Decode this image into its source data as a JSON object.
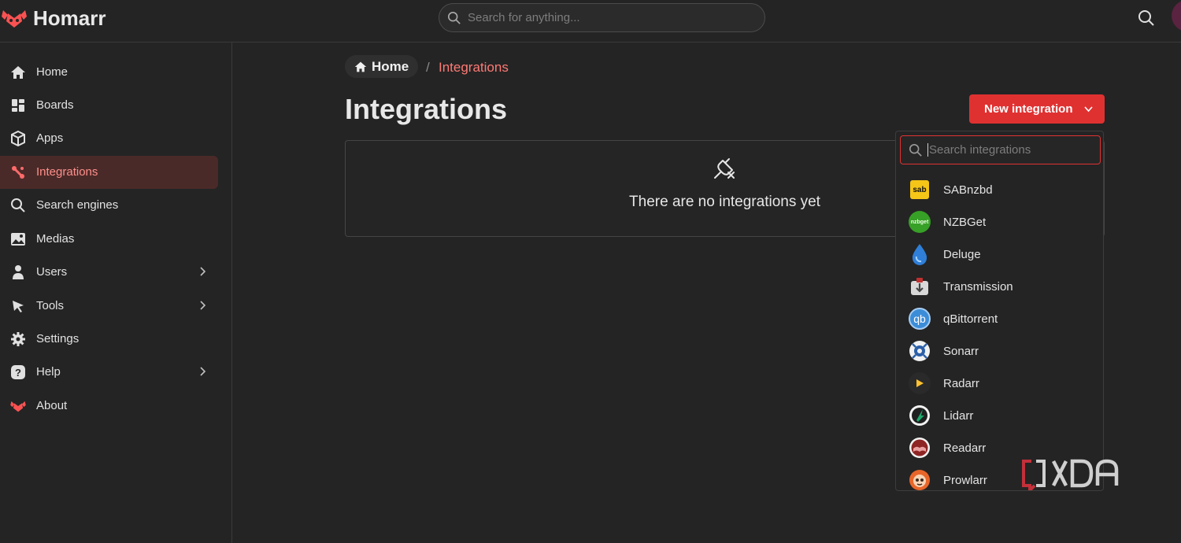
{
  "header": {
    "app_name": "Homarr",
    "search_placeholder": "Search for anything..."
  },
  "sidebar": {
    "items": [
      {
        "label": "Home",
        "icon": "home-icon"
      },
      {
        "label": "Boards",
        "icon": "boards-icon"
      },
      {
        "label": "Apps",
        "icon": "box-icon"
      },
      {
        "label": "Integrations",
        "icon": "integrations-icon",
        "active": true
      },
      {
        "label": "Search engines",
        "icon": "search-icon"
      },
      {
        "label": "Medias",
        "icon": "image-icon"
      },
      {
        "label": "Users",
        "icon": "user-icon",
        "expandable": true
      },
      {
        "label": "Tools",
        "icon": "cursor-icon",
        "expandable": true
      },
      {
        "label": "Settings",
        "icon": "gear-icon"
      },
      {
        "label": "Help",
        "icon": "help-icon",
        "expandable": true
      },
      {
        "label": "About",
        "icon": "homarr-logo-icon"
      }
    ]
  },
  "breadcrumb": {
    "home_label": "Home",
    "separator": "/",
    "current": "Integrations"
  },
  "main": {
    "title": "Integrations",
    "new_button_label": "New integration",
    "empty_message": "There are no integrations yet"
  },
  "dropdown": {
    "search_placeholder": "Search integrations",
    "items": [
      {
        "label": "SABnzbd",
        "icon": "sabnzbd-icon",
        "badge": "sab"
      },
      {
        "label": "NZBGet",
        "icon": "nzbget-icon",
        "badge": "nzbget"
      },
      {
        "label": "Deluge",
        "icon": "deluge-icon"
      },
      {
        "label": "Transmission",
        "icon": "transmission-icon"
      },
      {
        "label": "qBittorrent",
        "icon": "qbittorrent-icon",
        "badge": "qb"
      },
      {
        "label": "Sonarr",
        "icon": "sonarr-icon"
      },
      {
        "label": "Radarr",
        "icon": "radarr-icon"
      },
      {
        "label": "Lidarr",
        "icon": "lidarr-icon"
      },
      {
        "label": "Readarr",
        "icon": "readarr-icon"
      },
      {
        "label": "Prowlarr",
        "icon": "prowlarr-icon"
      }
    ]
  },
  "colors": {
    "accent": "#e03131",
    "active_text": "#ff8f8b",
    "background": "#242424"
  }
}
